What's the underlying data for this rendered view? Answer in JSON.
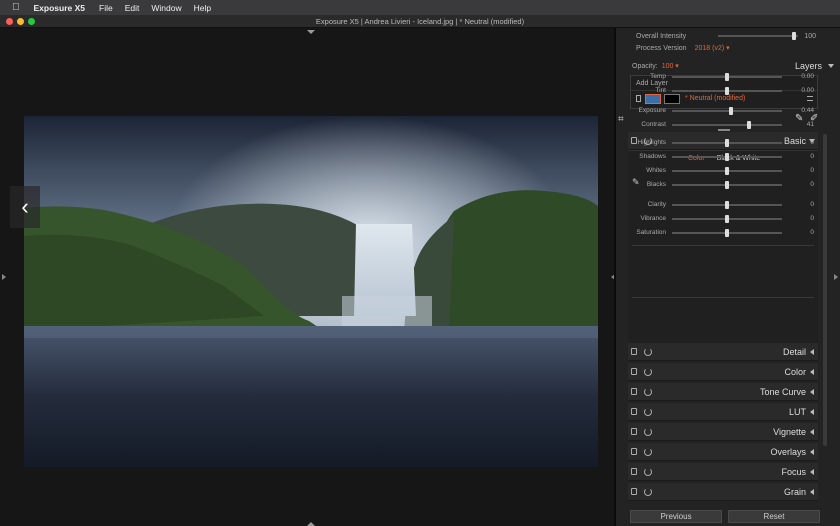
{
  "menubar": {
    "apple": "",
    "app": "Exposure X5",
    "items": [
      "File",
      "Edit",
      "Window",
      "Help"
    ]
  },
  "window": {
    "title": "Exposure X5 | Andrea Livieri - Iceland.jpg | * Neutral (modified)"
  },
  "top": {
    "overall_intensity_label": "Overall Intensity",
    "overall_intensity_value": "100",
    "process_version_label": "Process Version",
    "process_version_value": "2018 (v2) ▾",
    "opacity_label": "Opacity:",
    "opacity_value": "100 ▾",
    "layers_label": "Layers",
    "add_layer_label": "Add Layer",
    "layer_name": "* Neutral (modified)"
  },
  "basic": {
    "title": "Basic",
    "tab_color": "Color",
    "tab_bw": "Black & White",
    "adjustments": [
      {
        "name": "Temp",
        "value": "0.00",
        "pos": 0.5
      },
      {
        "name": "Tint",
        "value": "0.00",
        "pos": 0.5
      },
      {
        "name": "Exposure",
        "value": "0.44",
        "pos": 0.54
      },
      {
        "name": "Contrast",
        "value": "41",
        "pos": 0.7
      },
      {
        "name": "Highlights",
        "value": "0",
        "pos": 0.5
      },
      {
        "name": "Shadows",
        "value": "0",
        "pos": 0.5
      },
      {
        "name": "Whites",
        "value": "0",
        "pos": 0.5
      },
      {
        "name": "Blacks",
        "value": "0",
        "pos": 0.5
      },
      {
        "name": "Clarity",
        "value": "0",
        "pos": 0.5
      },
      {
        "name": "Vibrance",
        "value": "0",
        "pos": 0.5
      },
      {
        "name": "Saturation",
        "value": "0",
        "pos": 0.5
      }
    ]
  },
  "sections": [
    "Detail",
    "Color",
    "Tone Curve",
    "LUT",
    "Vignette",
    "Overlays",
    "Focus",
    "Grain"
  ],
  "buttons": {
    "previous": "Previous",
    "reset": "Reset"
  },
  "colors": {
    "accent": "#e2653a",
    "panel": "#232323"
  }
}
